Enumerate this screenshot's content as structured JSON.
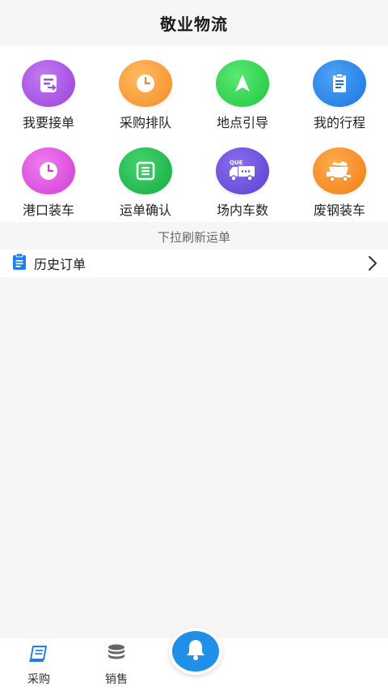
{
  "header": {
    "title": "敬业物流"
  },
  "grid": {
    "items": [
      {
        "label": "我要接单",
        "icon": "receipt-icon",
        "color": "#a24fe0"
      },
      {
        "label": "采购排队",
        "icon": "clock-icon",
        "color": "#f69a32"
      },
      {
        "label": "地点引导",
        "icon": "navigation-arrow-icon",
        "color": "#2bd34b"
      },
      {
        "label": "我的行程",
        "icon": "clipboard-icon",
        "color": "#1f7fe6"
      },
      {
        "label": "港口装车",
        "icon": "clock-icon",
        "color": "#d94ad8"
      },
      {
        "label": "运单确认",
        "icon": "list-box-icon",
        "color": "#1bb84a"
      },
      {
        "label": "场内车数",
        "icon": "queue-truck-icon",
        "color": "#6b4ed6",
        "badge": "QUE"
      },
      {
        "label": "废钢装车",
        "icon": "dump-truck-icon",
        "color": "#f58a1c"
      }
    ]
  },
  "pull_hint": "下拉刷新运单",
  "history": {
    "label": "历史订单"
  },
  "tabbar": {
    "tabs": [
      {
        "label": "采购",
        "icon": "document-icon"
      },
      {
        "label": "销售",
        "icon": "database-icon"
      }
    ],
    "center_icon": "bell-icon"
  },
  "colors": {
    "accent": "#1f8fe8",
    "background": "#f6f6f7"
  }
}
